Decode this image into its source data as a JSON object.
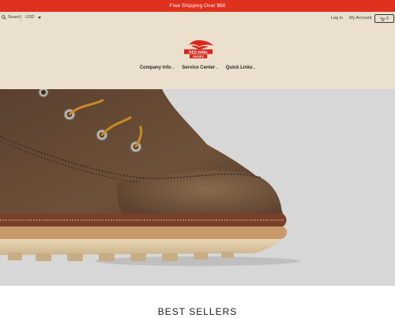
{
  "announcement": {
    "text": "Free Shipping Over $60"
  },
  "topbar": {
    "search_label": "Search",
    "currency": "USD",
    "login_label": "Log in",
    "account_label": "My Account",
    "cart_count": "0"
  },
  "logo": {
    "line1": "RED WING",
    "line2": "SHOES",
    "icon": "red-wing-logo"
  },
  "nav": {
    "items": [
      {
        "label": "Company Info"
      },
      {
        "label": "Service Center"
      },
      {
        "label": "Quick Links"
      }
    ]
  },
  "hero": {
    "image": "brown-moc-toe-boot"
  },
  "section": {
    "title": "BEST SELLERS"
  },
  "colors": {
    "announcement_bg": "#e0301e",
    "header_bg": "#ebe0cd",
    "hero_bg": "#d7d7d7",
    "brand_red": "#d9261c"
  }
}
